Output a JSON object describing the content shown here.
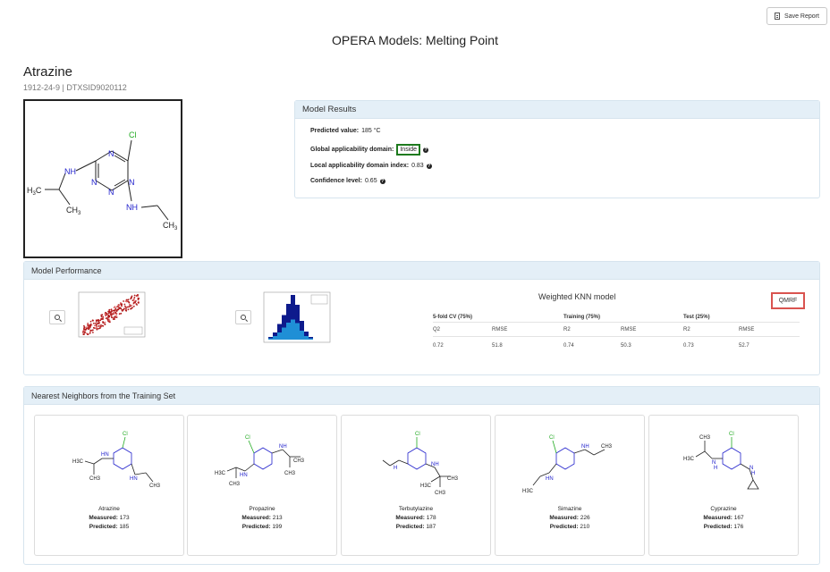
{
  "toolbar": {
    "save_label": "Save Report"
  },
  "page_title": "OPERA Models: Melting Point",
  "chemical": {
    "name": "Atrazine",
    "ids": "1912-24-9 | DTXSID9020112"
  },
  "results": {
    "heading": "Model Results",
    "predicted_label": "Predicted value:",
    "predicted_value": "185 °C",
    "global_ad_label": "Global applicability domain:",
    "global_ad_value": "Inside",
    "local_ad_label": "Local applicability domain index:",
    "local_ad_value": "0.83",
    "confidence_label": "Confidence level:",
    "confidence_value": "0.65",
    "help_glyph": "?"
  },
  "performance": {
    "heading": "Model Performance",
    "model_title": "Weighted KNN model",
    "qmrf_label": "QMRF",
    "groups": [
      "5-fold CV (75%)",
      "Training (75%)",
      "Test (25%)"
    ],
    "metrics": [
      "Q2",
      "RMSE",
      "R2",
      "RMSE",
      "R2",
      "RMSE"
    ],
    "values": [
      "0.72",
      "51.8",
      "0.74",
      "50.3",
      "0.73",
      "52.7"
    ],
    "histogram": {
      "bin_heights": [
        0.06,
        0.16,
        0.35,
        0.55,
        0.8,
        1.0,
        0.78,
        0.42,
        0.18,
        0.06
      ],
      "bin_heights_dark": [
        0.03,
        0.08,
        0.16,
        0.27,
        0.38,
        0.45,
        0.37,
        0.2,
        0.08,
        0.03
      ]
    }
  },
  "neighbors": {
    "heading": "Nearest Neighbors from the Training Set",
    "measured_label": "Measured:",
    "predicted_label": "Predicted:",
    "items": [
      {
        "name": "Atrazine",
        "measured": "173",
        "predicted": "185"
      },
      {
        "name": "Propazine",
        "measured": "213",
        "predicted": "199"
      },
      {
        "name": "Terbutylazine",
        "measured": "178",
        "predicted": "187"
      },
      {
        "name": "Simazine",
        "measured": "226",
        "predicted": "210"
      },
      {
        "name": "Cyprazine",
        "measured": "167",
        "predicted": "176"
      }
    ]
  },
  "colors": {
    "panel_header": "#e4eff7",
    "inside_border": "#1e7a1e",
    "qmrf_border": "#d9534f",
    "nitrogen": "#2222cc",
    "chlorine": "#22aa22",
    "hist_light": "#1f8fd6",
    "hist_dark": "#0d1a8c"
  }
}
